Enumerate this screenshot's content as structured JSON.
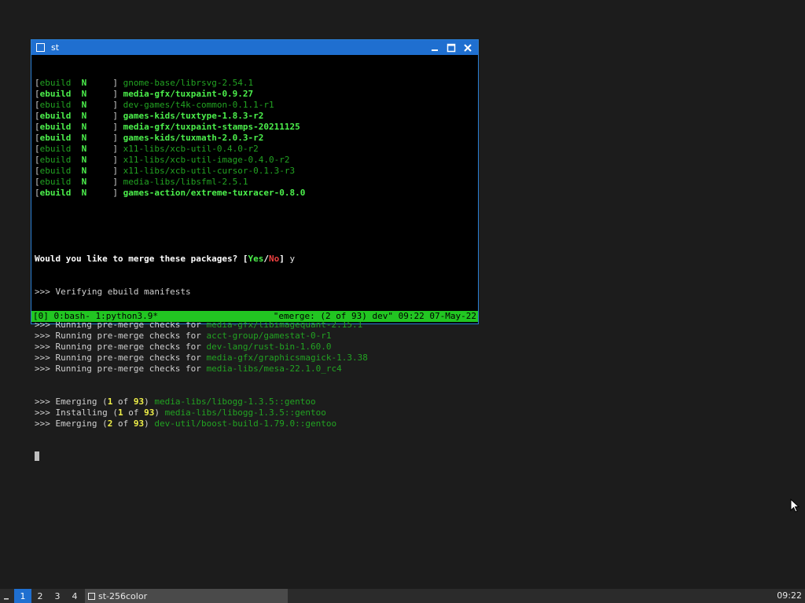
{
  "window": {
    "title": "st"
  },
  "terminal": {
    "ebuild_lines": [
      {
        "pkg": "gnome-base/librsvg-2.54.1",
        "bold": false
      },
      {
        "pkg": "media-gfx/tuxpaint-0.9.27",
        "bold": true
      },
      {
        "pkg": "dev-games/t4k-common-0.1.1-r1",
        "bold": false
      },
      {
        "pkg": "games-kids/tuxtype-1.8.3-r2",
        "bold": true
      },
      {
        "pkg": "media-gfx/tuxpaint-stamps-20211125",
        "bold": true
      },
      {
        "pkg": "games-kids/tuxmath-2.0.3-r2",
        "bold": true
      },
      {
        "pkg": "x11-libs/xcb-util-0.4.0-r2",
        "bold": false
      },
      {
        "pkg": "x11-libs/xcb-util-image-0.4.0-r2",
        "bold": false
      },
      {
        "pkg": "x11-libs/xcb-util-cursor-0.1.3-r3",
        "bold": false
      },
      {
        "pkg": "media-libs/libsfml-2.5.1",
        "bold": false
      },
      {
        "pkg": "games-action/extreme-tuxracer-0.8.0",
        "bold": true
      }
    ],
    "ebuild_label": "ebuild",
    "ebuild_flag": "N",
    "merge_prompt": {
      "question": "Would you like to merge these packages? ",
      "yes": "Yes",
      "no": "No",
      "answer": "y"
    },
    "verify_line": ">>> Verifying ebuild manifests",
    "premerge_prefix": ">>> Running pre-merge checks for ",
    "premerge_pkgs": [
      "media-gfx/libimagequant-2.15.1",
      "acct-group/gamestat-0-r1",
      "dev-lang/rust-bin-1.60.0",
      "media-gfx/graphicsmagick-1.3.38",
      "media-libs/mesa-22.1.0_rc4"
    ],
    "progress_lines": [
      {
        "verb": ">>> Emerging (",
        "n": "1",
        "total": "93",
        "pkg": "media-libs/libogg-1.3.5::gentoo"
      },
      {
        "verb": ">>> Installing (",
        "n": "1",
        "total": "93",
        "pkg": "media-libs/libogg-1.3.5::gentoo"
      },
      {
        "verb": ">>> Emerging (",
        "n": "2",
        "total": "93",
        "pkg": "dev-util/boost-build-1.79.0::gentoo"
      }
    ],
    "of_word": " of "
  },
  "tmux_status": {
    "left": "[0] 0:bash- 1:python3.9*",
    "right": "\"emerge: (2 of 93) dev\" 09:22 07-May-22"
  },
  "taskbar": {
    "workspaces": [
      "1",
      "2",
      "3",
      "4"
    ],
    "active_workspace": "1",
    "task_label": "st-256color",
    "clock": "09:22"
  },
  "colors": {
    "titlebar": "#1f6fd0",
    "status_green": "#22c622",
    "bright_green": "#4cf04c",
    "dim_green": "#22a322",
    "yellow": "#f0f048",
    "red": "#f04040"
  }
}
